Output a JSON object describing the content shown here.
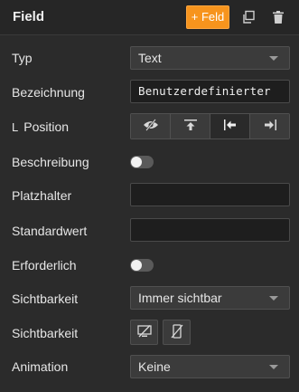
{
  "header": {
    "title": "Field",
    "add_button_label": "+ Feld",
    "icons": [
      "copy-icon",
      "trash-icon"
    ]
  },
  "rows": {
    "typ": {
      "label": "Typ",
      "value": "Text"
    },
    "bezeichnung": {
      "label": "Bezeichnung",
      "value": "Benutzerdefinierter"
    },
    "position": {
      "marker": "L",
      "label": "Position",
      "options": [
        "hidden-icon",
        "top-icon",
        "left-icon",
        "right-icon"
      ],
      "selected": "left-icon"
    },
    "beschreibung": {
      "label": "Beschreibung",
      "enabled": false
    },
    "platzhalter": {
      "label": "Platzhalter",
      "value": ""
    },
    "standardwert": {
      "label": "Standardwert",
      "value": ""
    },
    "erforderlich": {
      "label": "Erforderlich",
      "enabled": false
    },
    "sichtbarkeit_select": {
      "label": "Sichtbarkeit",
      "value": "Immer sichtbar"
    },
    "sichtbarkeit_buttons": {
      "label": "Sichtbarkeit",
      "icons": [
        "hide-desktop-icon",
        "hide-mobile-icon"
      ]
    },
    "animation": {
      "label": "Animation",
      "value": "Keine"
    }
  },
  "colors": {
    "accent": "#f7941d",
    "background": "#2b2b2b",
    "header_background": "#262626"
  }
}
